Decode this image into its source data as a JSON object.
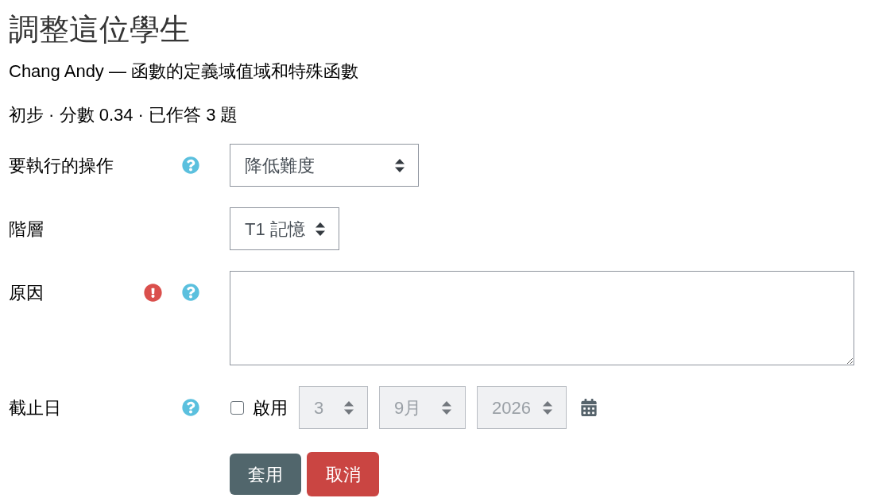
{
  "title": "調整這位學生",
  "subtitle": "Chang Andy — 函數的定義域值域和特殊函數",
  "summary": "初步 · 分數 0.34 · 已作答 3 題",
  "form": {
    "fields": [
      {
        "kind": "select",
        "label": "要執行的操作",
        "required": false,
        "help": true,
        "value": "降低難度"
      },
      {
        "kind": "select",
        "label": "階層",
        "required": false,
        "help": false,
        "value": "T1 記憶"
      },
      {
        "kind": "textarea",
        "label": "原因",
        "required": true,
        "help": true
      },
      {
        "kind": "date",
        "label": "截止日",
        "required": false,
        "help": true,
        "checkbox": {
          "label": "啟用",
          "checked": false
        },
        "parts": [
          {
            "value": "3",
            "disabled": true
          },
          {
            "value": "9月",
            "disabled": true
          },
          {
            "value": "2026",
            "disabled": true
          }
        ]
      }
    ]
  },
  "buttons": [
    {
      "label": "套用",
      "kind": "primary"
    },
    {
      "label": "取消",
      "kind": "danger"
    }
  ]
}
